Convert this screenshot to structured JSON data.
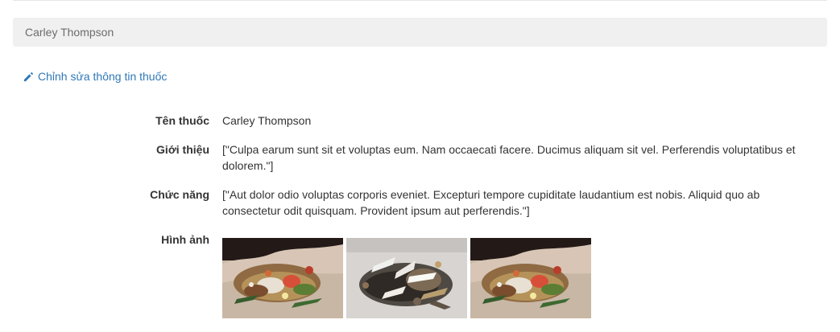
{
  "breadcrumb": {
    "current": "Carley Thompson"
  },
  "actions": {
    "edit_label": "Chỉnh sửa thông tin thuốc",
    "edit_icon": "pencil-icon"
  },
  "drug": {
    "name_label": "Tên thuốc",
    "name_value": "Carley Thompson",
    "intro_label": "Giới thiệu",
    "intro_value": "[\"Culpa earum sunt sit et voluptas eum. Nam occaecati facere. Ducimus aliquam sit vel. Perferendis voluptatibus et dolorem.\"]",
    "function_label": "Chức năng",
    "function_value": "[\"Aut dolor odio voluptas corporis eveniet. Excepturi tempore cupiditate laudantium est nobis. Aliquid quo ab consectetur odit quisquam. Provident ipsum aut perferendis.\"]",
    "images_label": "Hình ảnh"
  },
  "colors": {
    "link": "#2f78b7",
    "breadcrumb_bg": "#f0f0f0",
    "text": "#333333"
  },
  "images": [
    {
      "name": "herb-image-1"
    },
    {
      "name": "herb-image-2"
    },
    {
      "name": "herb-image-3"
    }
  ]
}
